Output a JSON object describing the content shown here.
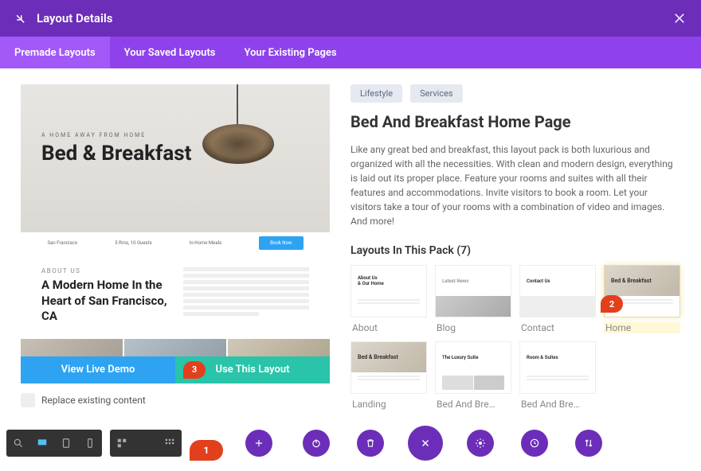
{
  "header": {
    "title": "Layout Details"
  },
  "tabs": [
    "Premade Layouts",
    "Your Saved Layouts",
    "Your Existing Pages"
  ],
  "preview": {
    "tagline": "A HOME AWAY FROM HOME",
    "title": "Bed & Breakfast",
    "strip": [
      "San Francisco",
      "5 Rms, 10 Guests",
      "In-Home Meals",
      "Book Now"
    ],
    "about_tag": "ABOUT US",
    "about_heading": "A Modern Home In the Heart of San Francisco, CA"
  },
  "actions": {
    "demo": "View Live Demo",
    "use": "Use This Layout",
    "replace": "Replace existing content"
  },
  "categories": [
    "Lifestyle",
    "Services"
  ],
  "details": {
    "title": "Bed And Breakfast Home Page",
    "description": "Like any great bed and breakfast, this layout pack is both luxurious and organized with all the necessities. With clean and modern design, everything is laid out its proper place. Feature your rooms and suites with all their features and accommodations. Invite visitors to book a room. Let your visitors take a tour of your rooms with a combination of video and images. And more!",
    "pack_title": "Layouts In This Pack (7)"
  },
  "layouts": [
    "About",
    "Blog",
    "Contact",
    "Home",
    "Landing",
    "Bed And Bre…",
    "Bed And Bre…"
  ],
  "markers": {
    "m1": "1",
    "m2": "2",
    "m3": "3"
  }
}
